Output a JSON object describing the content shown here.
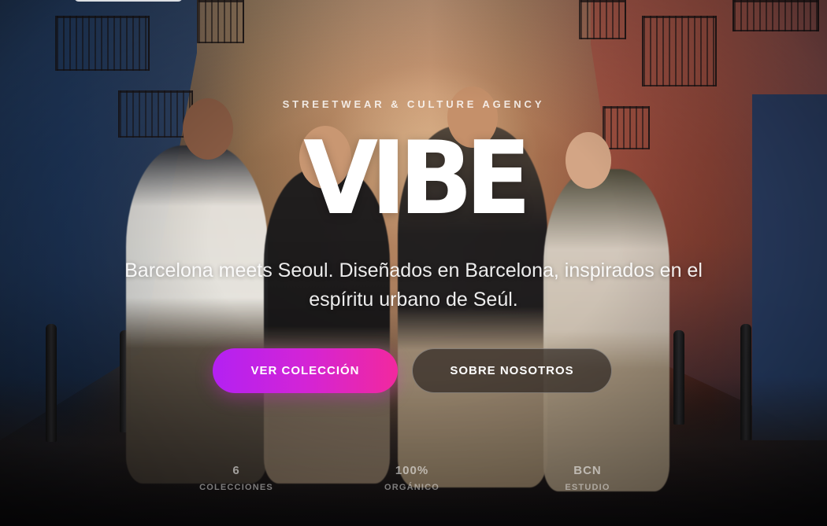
{
  "hero": {
    "eyebrow": "STREETWEAR & CULTURE AGENCY",
    "title": "VIBE",
    "subtitle": "Barcelona meets Seoul. Diseñados en Barcelona, inspirados en el espíritu urbano de Seúl."
  },
  "buttons": {
    "primary_label": "VER COLECCIÓN",
    "secondary_label": "SOBRE NOSOTROS"
  },
  "stats": [
    {
      "value": "6",
      "label": "COLECCIONES"
    },
    {
      "value": "100%",
      "label": "ORGÁNICO"
    },
    {
      "value": "BCN",
      "label": "ESTUDIO"
    }
  ],
  "colors": {
    "primary_gradient_start": "#b321f2",
    "primary_gradient_end": "#f2289e",
    "text": "#ffffff"
  },
  "background": {
    "image_description_icon": "street-photo-background"
  }
}
